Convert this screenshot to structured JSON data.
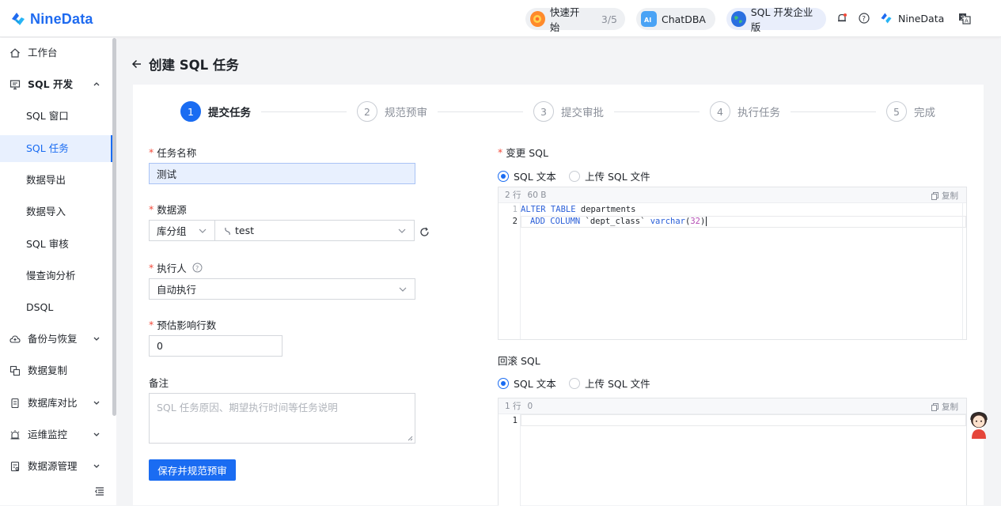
{
  "topbar": {
    "logo_text": "NineData",
    "quickstart": {
      "label": "快速开始",
      "progress": "3/5"
    },
    "chatdba_label": "ChatDBA",
    "edition_label": "SQL 开发企业版",
    "user_label": "NineData"
  },
  "sidebar": {
    "items": [
      {
        "label": "工作台"
      },
      {
        "label": "SQL 开发"
      },
      {
        "label": "SQL 窗口"
      },
      {
        "label": "SQL 任务"
      },
      {
        "label": "数据导出"
      },
      {
        "label": "数据导入"
      },
      {
        "label": "SQL 审核"
      },
      {
        "label": "慢查询分析"
      },
      {
        "label": "DSQL"
      },
      {
        "label": "备份与恢复"
      },
      {
        "label": "数据复制"
      },
      {
        "label": "数据库对比"
      },
      {
        "label": "运维监控"
      },
      {
        "label": "数据源管理"
      }
    ]
  },
  "page": {
    "title": "创建 SQL 任务"
  },
  "steps": [
    {
      "num": "1",
      "label": "提交任务"
    },
    {
      "num": "2",
      "label": "规范预审"
    },
    {
      "num": "3",
      "label": "提交审批"
    },
    {
      "num": "4",
      "label": "执行任务"
    },
    {
      "num": "5",
      "label": "完成"
    }
  ],
  "form": {
    "task_name": {
      "label": "任务名称",
      "value": "测试"
    },
    "datasource": {
      "label": "数据源",
      "group_value": "库分组",
      "source_value": "test"
    },
    "executor": {
      "label": "执行人",
      "value": "自动执行"
    },
    "rows": {
      "label": "预估影响行数",
      "value": "0"
    },
    "remark": {
      "label": "备注",
      "placeholder": "SQL 任务原因、期望执行时间等任务说明"
    },
    "save_button": "保存并规范预审"
  },
  "change_sql": {
    "label": "变更 SQL",
    "option_text": "SQL 文本",
    "option_upload": "上传 SQL 文件",
    "meta_lines": "2 行",
    "meta_size": "60 B",
    "copy_label": "复制",
    "line_numbers": [
      "1",
      "2"
    ],
    "line1": {
      "kw": "ALTER TABLE",
      "rest": " departments"
    },
    "line2": {
      "kw1": "ADD COLUMN",
      "ident": " `dept_class` ",
      "kw2": "varchar",
      "paren_open": "(",
      "num": "32",
      "paren_close": ")"
    }
  },
  "rollback_sql": {
    "label": "回滚 SQL",
    "option_text": "SQL 文本",
    "option_upload": "上传 SQL 文件",
    "meta_lines": "1 行",
    "meta_size": "0",
    "copy_label": "复制",
    "line_numbers": [
      "1"
    ]
  },
  "colors": {
    "primary": "#1a6cf2",
    "required": "#f24a3a",
    "active_bg": "#e8f0fe"
  }
}
